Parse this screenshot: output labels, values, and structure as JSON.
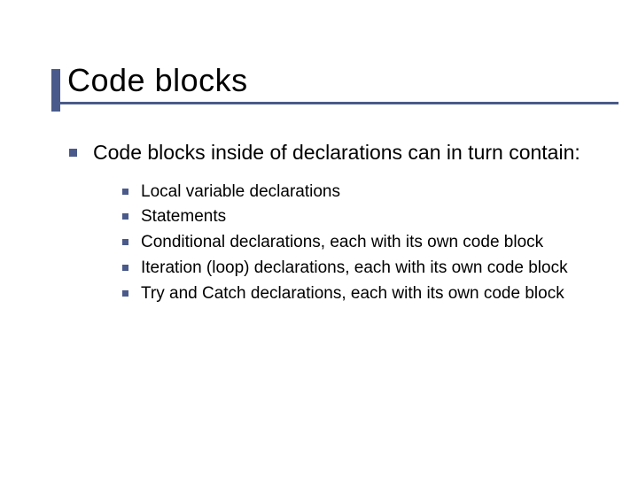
{
  "title": "Code blocks",
  "intro": "Code blocks inside of declarations can in turn contain:",
  "items": [
    "Local variable declarations",
    "Statements",
    "Conditional declarations, each with its own code block",
    "Iteration (loop) declarations, each with its own code block",
    "Try and Catch declarations, each with its own code block"
  ]
}
